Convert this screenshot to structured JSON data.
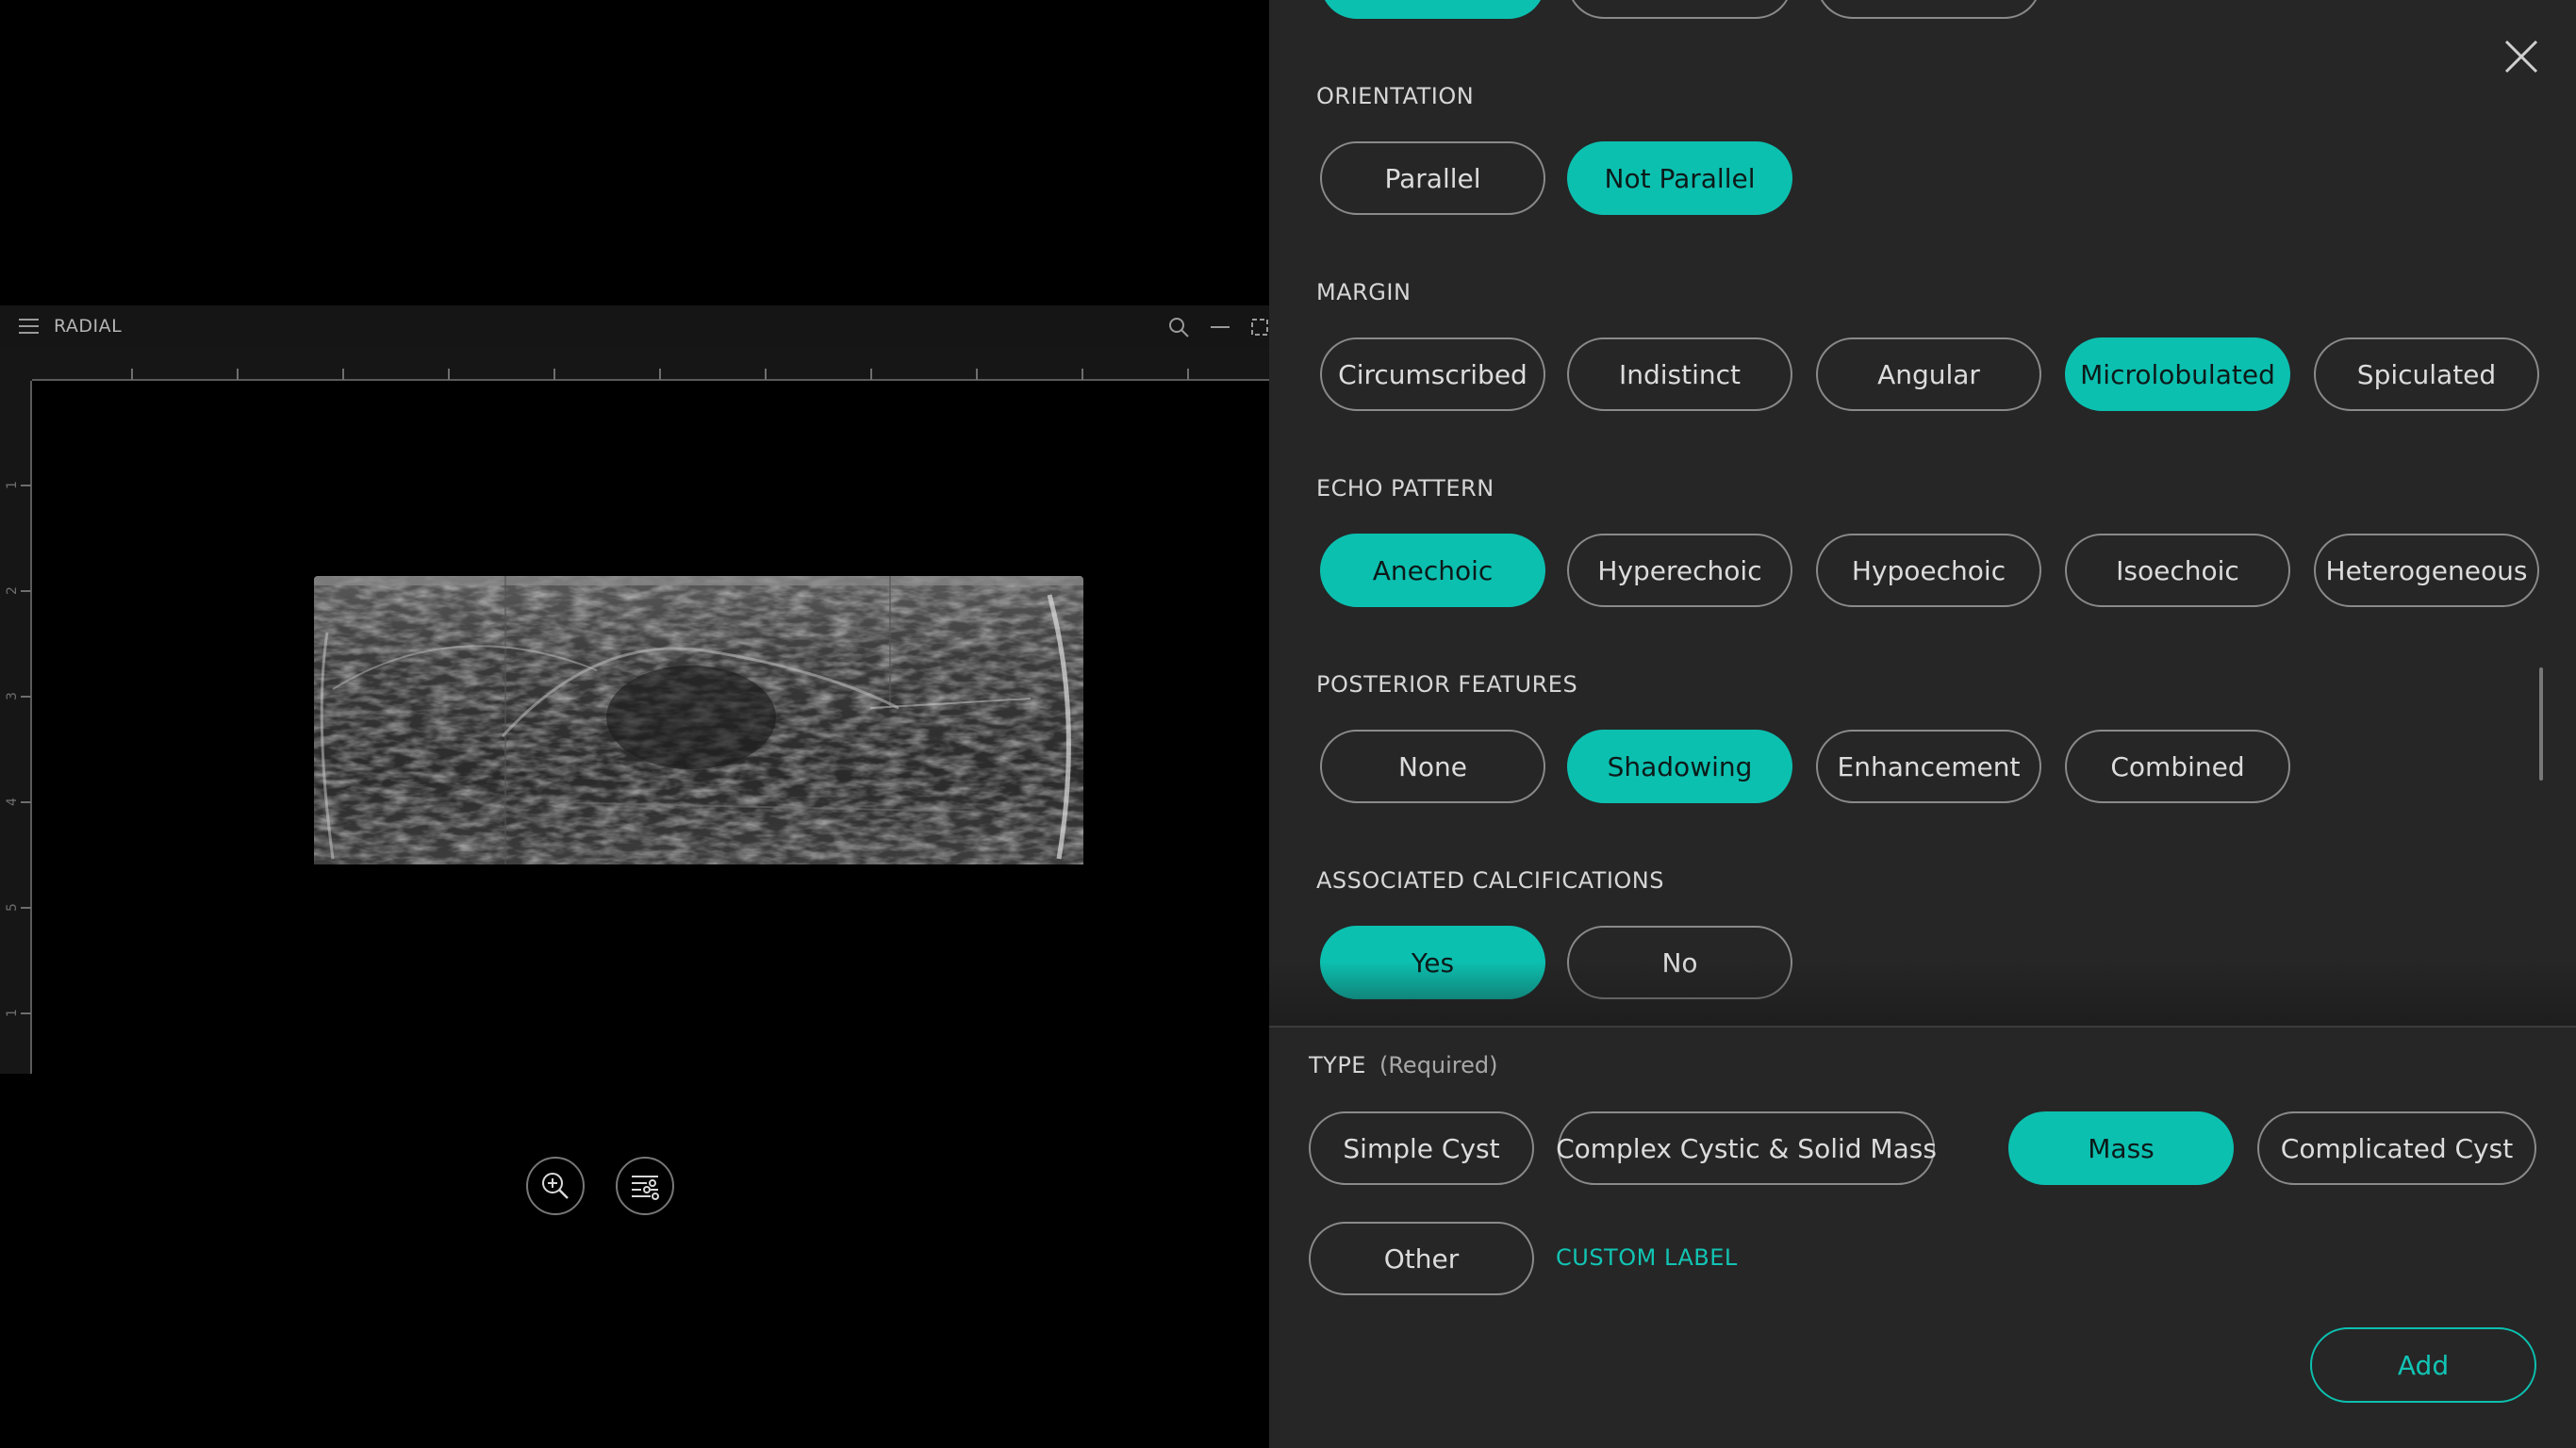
{
  "viewer": {
    "title": "RADIAL",
    "ruler_labels": [
      "1",
      "2",
      "3",
      "4",
      "5",
      "1"
    ]
  },
  "panel": {
    "sections": [
      {
        "key": "orientation",
        "title": "ORIENTATION",
        "options": [
          "Parallel",
          "Not Parallel"
        ],
        "selected": "Not Parallel"
      },
      {
        "key": "margin",
        "title": "MARGIN",
        "options": [
          "Circumscribed",
          "Indistinct",
          "Angular",
          "Microlobulated",
          "Spiculated"
        ],
        "selected": "Microlobulated"
      },
      {
        "key": "echo",
        "title": "ECHO PATTERN",
        "options": [
          "Anechoic",
          "Hyperechoic",
          "Hypoechoic",
          "Isoechoic",
          "Heterogeneous"
        ],
        "selected": "Anechoic"
      },
      {
        "key": "posterior",
        "title": "POSTERIOR FEATURES",
        "options": [
          "None",
          "Shadowing",
          "Enhancement",
          "Combined"
        ],
        "selected": "Shadowing"
      },
      {
        "key": "calc",
        "title": "ASSOCIATED CALCIFICATIONS",
        "options": [
          "Yes",
          "No"
        ],
        "selected": "Yes"
      }
    ],
    "type": {
      "title": "TYPE",
      "required_note": "(Required)",
      "options": [
        "Simple Cyst",
        "Complex Cystic & Solid Mass",
        "Mass",
        "Complicated Cyst",
        "Other"
      ],
      "selected": "Mass",
      "custom_label": "CUSTOM LABEL"
    },
    "add_label": "Add"
  },
  "colors": {
    "accent": "#0cc0b0",
    "panel_bg": "#262626",
    "pill_border": "#8a8a8a"
  },
  "icons": [
    "hamburger-icon",
    "search-icon",
    "minimize-icon",
    "expand-icon",
    "zoom-in-icon",
    "adjust-icon",
    "close-icon"
  ]
}
